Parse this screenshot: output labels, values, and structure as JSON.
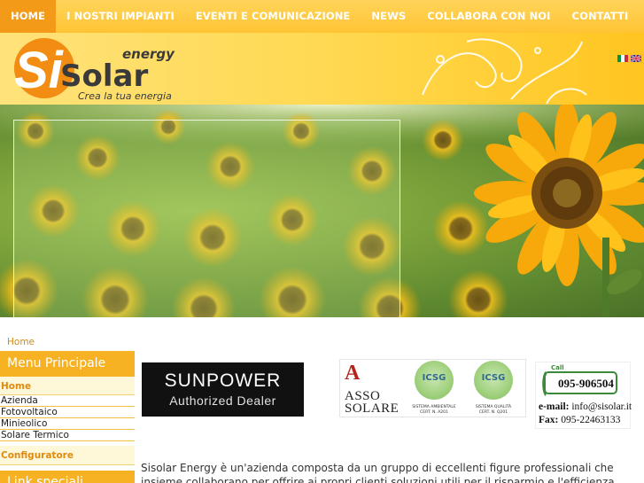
{
  "nav": {
    "items": [
      {
        "label": "HOME",
        "active": true
      },
      {
        "label": "I NOSTRI IMPIANTI",
        "active": false
      },
      {
        "label": "EVENTI E COMUNICAZIONE",
        "active": false
      },
      {
        "label": "NEWS",
        "active": false
      },
      {
        "label": "COLLABORA CON NOI",
        "active": false
      },
      {
        "label": "CONTATTI",
        "active": false
      }
    ]
  },
  "logo": {
    "mark": "Si",
    "brand": "Solar",
    "sub": "energy",
    "tagline": "Crea la tua energia"
  },
  "languages": [
    "it-flag-icon",
    "en-flag-icon"
  ],
  "breadcrumb": {
    "label": "Home"
  },
  "sidebar": {
    "title": "Menu Principale",
    "section1": "Home",
    "links": [
      "Azienda",
      "Fotovoltaico",
      "Minieolico",
      "Solare Termico"
    ],
    "section2": "Configuratore",
    "title2": "Link speciali"
  },
  "sunpower": {
    "brand": "SUNPOWER",
    "tagline": "Authorized Dealer"
  },
  "certs": {
    "asso_line1": "ASSO",
    "asso_line2": "SOLARE",
    "icsg": [
      {
        "seal": "ICSG",
        "cap1": "SISTEMA AMBIENTALE",
        "cap2": "CERT. N. A201"
      },
      {
        "seal": "ICSG",
        "cap1": "SISTEMA QUALITÀ",
        "cap2": "CERT. N. Q201"
      }
    ]
  },
  "contact": {
    "call_label": "Call",
    "phone": "095-906504",
    "email_label": "e-mail:",
    "email": "info@sisolar.it",
    "fax_label": "Fax:",
    "fax": "095-22463133"
  },
  "intro": {
    "text": "Sisolar Energy è un'azienda composta da un gruppo di eccellenti figure professionali che insieme collaborano per offrire ai propri clienti soluzioni utili per il risparmio e l'efficienza energetica attraverso"
  },
  "colors": {
    "nav_bg": "#ffc434",
    "nav_active": "#f39a18",
    "accent": "#f7b224",
    "link": "#e08a10"
  }
}
